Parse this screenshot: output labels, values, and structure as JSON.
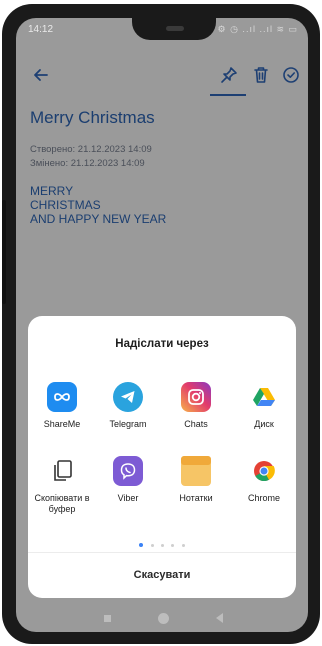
{
  "status_bar": {
    "time": "14:12",
    "icons": "◔ ⚙ ◷ ..ıl ..ıl ≋ ▭"
  },
  "toolbar": {
    "back_icon": "arrow-left-icon",
    "pin_icon": "pin-icon",
    "trash_icon": "trash-icon",
    "check_icon": "check-circle-icon",
    "accent_color": "#1d3f73"
  },
  "note": {
    "title": "Merry Christmas",
    "created": "Створено: 21.12.2023 14:09",
    "modified": "Змінено: 21.12.2023 14:09",
    "body_lines": [
      "MERRY",
      "CHRISTMAS",
      "AND HAPPY NEW YEAR"
    ]
  },
  "share_sheet": {
    "title": "Надіслати через",
    "apps": [
      {
        "label": "ShareMe",
        "icon": "shareme-icon",
        "color": "#1e8cf0"
      },
      {
        "label": "Telegram",
        "icon": "telegram-icon",
        "color": "#2aa3de"
      },
      {
        "label": "Chats",
        "icon": "instagram-icon",
        "color": "#d6306c"
      },
      {
        "label": "Диск",
        "icon": "google-drive-icon",
        "color": "#1fa463"
      },
      {
        "label": "Скопіювати в буфер",
        "icon": "copy-icon",
        "color": "#333333"
      },
      {
        "label": "Viber",
        "icon": "viber-icon",
        "color": "#7d5bd4"
      },
      {
        "label": "Нотатки",
        "icon": "notes-icon",
        "color": "#f3b74f"
      },
      {
        "label": "Chrome",
        "icon": "chrome-icon",
        "color": "#e44134"
      }
    ],
    "page_count": 5,
    "active_page": 1,
    "cancel_label": "Скасувати"
  },
  "nav_bar": {
    "icons": [
      "recents-icon",
      "home-icon",
      "back-icon"
    ]
  }
}
